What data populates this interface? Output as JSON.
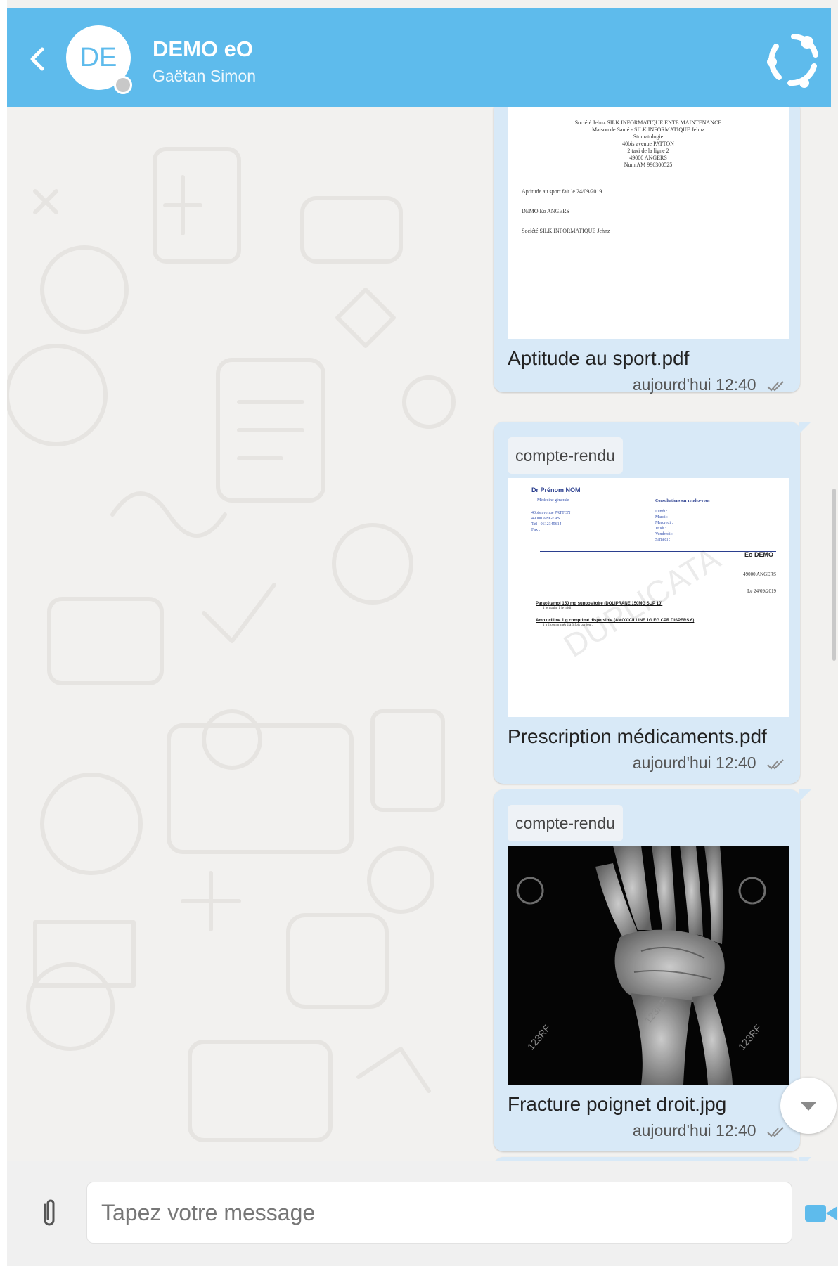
{
  "header": {
    "avatar_initials": "DE",
    "contact_name": "DEMO eO",
    "contact_subtitle": "Gaëtan  Simon",
    "accent_color": "#5ebbec"
  },
  "messages": [
    {
      "tag": null,
      "file_name": "Aptitude au sport.pdf",
      "time": "aujourd'hui 12:40",
      "preview": {
        "lines_top": [
          "Société Jehnz SILK INFORMATIQUE ENTE MAINTENANCE",
          "Maison de Santé - SILK INFORMATIQUE Jehnz",
          "Stomatologie",
          "40bis avenue PATTON",
          "2 taxi de la ligne 2",
          "49000 ANGERS",
          "Num AM 996300525"
        ],
        "line_a": "Aptitude au sport fait le 24/09/2019",
        "line_b": "DEMO Eo ANGERS",
        "line_c": "Société SILK INFORMATIQUE Jehnz"
      }
    },
    {
      "tag": "compte-rendu",
      "file_name": "Prescription médicaments.pdf",
      "time": "aujourd'hui 12:40",
      "preview": {
        "doctor": "Dr Prénom NOM",
        "specialty": "Médecine générale",
        "address": [
          "40bis avenue PATTON",
          "49000 ANGERS",
          "Tél : 0612345614",
          "Fax :"
        ],
        "consult_title": "Consultations sur rendez-vous",
        "days": [
          "Lundi :",
          "Mardi :",
          "Mercredi :",
          "Jeudi :",
          "Vendredi :",
          "Samedi :"
        ],
        "patient": "Eo DEMO",
        "city": "49000 ANGERS",
        "date": "Le 24/09/2019",
        "rx1": "Paracétamol 150 mg suppositoire  (DOLIPRANE 150MG SUP 10)",
        "rx1_detail": "1 le matin, 1 le midi",
        "rx2": "Amoxicilline 1 g comprimé dispersible  (AMOXICILLINE 1G EG CPR DISPERS 6)",
        "rx2_detail": "1 à 2 comprimés 2 à 3 fois par jour.",
        "watermark": "DUPLICATA"
      }
    },
    {
      "tag": "compte-rendu",
      "file_name": "Fracture poignet droit.jpg",
      "time": "aujourd'hui 12:40",
      "preview": {
        "wm1": "123RF",
        "wm2": "123RF",
        "wm3": "123RF"
      }
    }
  ],
  "composer": {
    "placeholder": "Tapez votre message"
  },
  "icons": {
    "back": "chevron-left-icon",
    "logo": "app-logo-icon",
    "attach": "paperclip-icon",
    "video": "video-camera-icon",
    "read": "double-check-icon",
    "scroll": "chevron-down-icon"
  }
}
